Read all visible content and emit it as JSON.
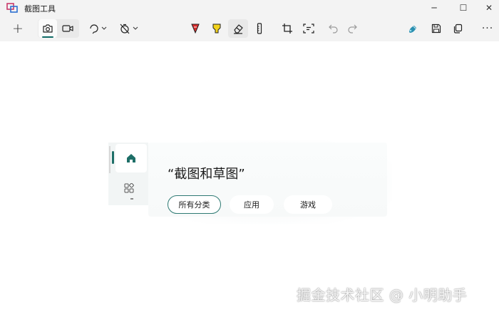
{
  "window": {
    "title": "截图工具",
    "controls": {
      "minimize": "─",
      "maximize": "☐",
      "close": "✕"
    }
  },
  "toolbar": {
    "new_label": "+",
    "more_label": "···",
    "tools": [
      {
        "id": "new",
        "icon": "plus-icon"
      },
      {
        "id": "photo-mode",
        "icon": "camera-icon",
        "selected": true
      },
      {
        "id": "video-mode",
        "icon": "video-icon"
      },
      {
        "id": "snip-shape",
        "icon": "snip-shape-icon"
      },
      {
        "id": "delay",
        "icon": "timer-off-icon"
      },
      {
        "id": "ballpoint-pen",
        "icon": "red-pen-icon"
      },
      {
        "id": "highlighter",
        "icon": "yellow-highlighter-icon"
      },
      {
        "id": "eraser",
        "icon": "eraser-icon",
        "active": true
      },
      {
        "id": "ruler",
        "icon": "ruler-icon"
      },
      {
        "id": "crop",
        "icon": "crop-icon"
      },
      {
        "id": "text-actions",
        "icon": "text-actions-icon"
      },
      {
        "id": "undo",
        "icon": "undo-icon",
        "disabled": true
      },
      {
        "id": "redo",
        "icon": "redo-icon",
        "disabled": true
      },
      {
        "id": "edit-in-paint",
        "icon": "paint-icon"
      },
      {
        "id": "save",
        "icon": "save-icon"
      },
      {
        "id": "copy",
        "icon": "copy-icon"
      },
      {
        "id": "more",
        "icon": "more-icon"
      }
    ]
  },
  "snip": {
    "title": "“截图和草图”",
    "chips": [
      {
        "label": "所有分类",
        "selected": true
      },
      {
        "label": "应用",
        "selected": false
      },
      {
        "label": "游戏",
        "selected": false
      }
    ]
  },
  "watermark": "掘金技术社区 @ 小明助手",
  "colors": {
    "accent": "#0f6b66",
    "pen_red": "#d92b2b",
    "highlighter_yellow": "#f2d21b",
    "chrome_bg": "#f3f3f3",
    "canvas_bg": "#ffffff"
  }
}
